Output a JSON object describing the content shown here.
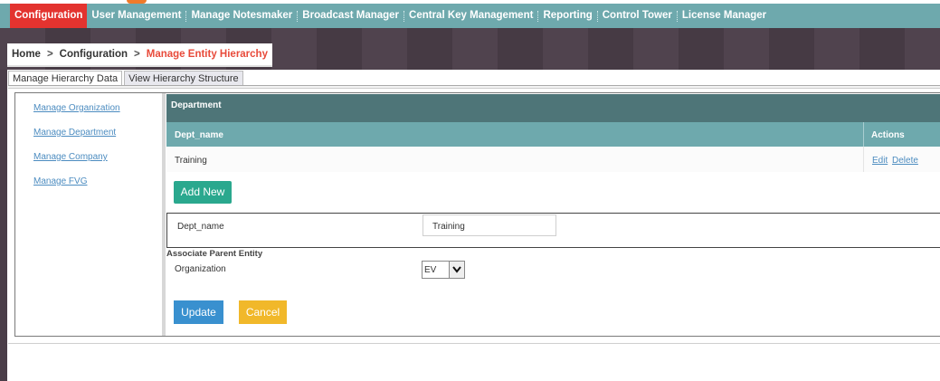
{
  "nav": {
    "items": [
      {
        "label": "Configuration",
        "active": true
      },
      {
        "label": "User Management"
      },
      {
        "label": "Manage Notesmaker"
      },
      {
        "label": "Broadcast Manager"
      },
      {
        "label": "Central Key Management"
      },
      {
        "label": "Reporting"
      },
      {
        "label": "Control Tower"
      },
      {
        "label": "License Manager"
      }
    ]
  },
  "breadcrumb": {
    "home": "Home",
    "section": "Configuration",
    "current": "Manage Entity Hierarchy",
    "separator": ">"
  },
  "tabs": {
    "manage": "Manage Hierarchy Data",
    "view": "View Hierarchy Structure"
  },
  "sidebar": {
    "items": [
      {
        "label": "Manage Organization"
      },
      {
        "label": "Manage Department"
      },
      {
        "label": "Manage Company"
      },
      {
        "label": "Manage FVG"
      }
    ]
  },
  "table": {
    "title": "Department",
    "columns": [
      "Dept_name",
      "Actions"
    ],
    "rows": [
      {
        "dept_name": "Training",
        "edit": "Edit",
        "delete": "Delete"
      }
    ]
  },
  "form": {
    "add_new": "Add New",
    "dept_label": "Dept_name",
    "dept_value": "Training",
    "assoc_title": "Associate Parent Entity",
    "org_label": "Organization",
    "org_value": "EV",
    "update": "Update",
    "cancel": "Cancel"
  },
  "colors": {
    "nav_bg": "#6ea9ad",
    "nav_active": "#e3332f",
    "header_dark": "#4e7578",
    "add_button": "#2aa88e",
    "update_button": "#3990cf",
    "cancel_button": "#f1b82a",
    "breadcrumb_current": "#e84a3a"
  },
  "icons": {
    "select_arrow": "chevron-down-icon"
  }
}
